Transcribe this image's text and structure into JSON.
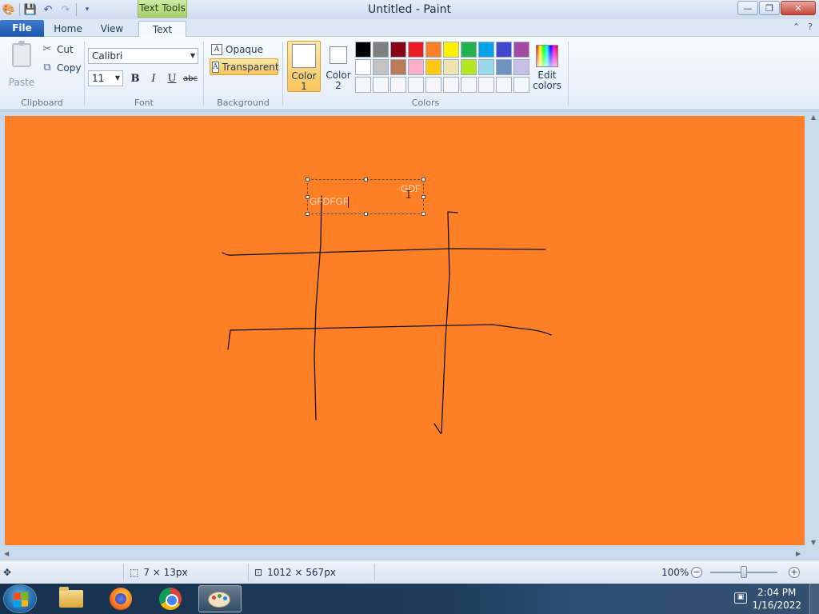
{
  "window": {
    "title": "Untitled - Paint",
    "context_tab": "Text Tools",
    "controls": {
      "minimize": "—",
      "restore": "❐",
      "close": "✕"
    }
  },
  "quick_access": {
    "icons": [
      "paint-app-icon",
      "save-icon",
      "undo-icon",
      "redo-icon",
      "customize-icon"
    ]
  },
  "tabs": {
    "file": "File",
    "home": "Home",
    "view": "View",
    "text": "Text",
    "active": "Text"
  },
  "ribbon": {
    "clipboard": {
      "label": "Clipboard",
      "paste": "Paste",
      "cut": "Cut",
      "copy": "Copy"
    },
    "font": {
      "label": "Font",
      "family": "Calibri",
      "size": "11",
      "bold": "B",
      "italic": "I",
      "underline": "U",
      "strikethrough": "abc"
    },
    "background": {
      "label": "Background",
      "opaque": "Opaque",
      "transparent": "Transparent",
      "selected": "Transparent"
    },
    "colors": {
      "label": "Colors",
      "color1_label_a": "Color",
      "color1_label_b": "1",
      "color2_label_a": "Color",
      "color2_label_b": "2",
      "color1": "#ffffff",
      "color2": "#ffffff",
      "edit_a": "Edit",
      "edit_b": "colors",
      "palette": [
        "#000000",
        "#7f7f7f",
        "#880015",
        "#ed1c24",
        "#ff7f27",
        "#fff200",
        "#22b14c",
        "#00a2e8",
        "#3f48cc",
        "#a349a4",
        "#ffffff",
        "#c3c3c3",
        "#b97a57",
        "#ffaec9",
        "#ffc90e",
        "#efe4b0",
        "#b5e61d",
        "#99d9ea",
        "#7092be",
        "#c8bfe7",
        "#f5f7fa",
        "#f5f7fa",
        "#f5f7fa",
        "#f5f7fa",
        "#f5f7fa",
        "#f5f7fa",
        "#f5f7fa",
        "#f5f7fa",
        "#f5f7fa",
        "#f5f7fa"
      ]
    }
  },
  "canvas": {
    "background": "#ff7f27",
    "textbox": {
      "line1": "GDF",
      "line2": "GFDFGF"
    }
  },
  "status": {
    "selection_size": "7 × 13px",
    "image_size": "1012 × 567px",
    "zoom": "100%"
  },
  "taskbar": {
    "apps": [
      "file-explorer",
      "firefox",
      "chrome",
      "paint"
    ],
    "time": "2:04 PM",
    "date": "1/16/2022"
  }
}
